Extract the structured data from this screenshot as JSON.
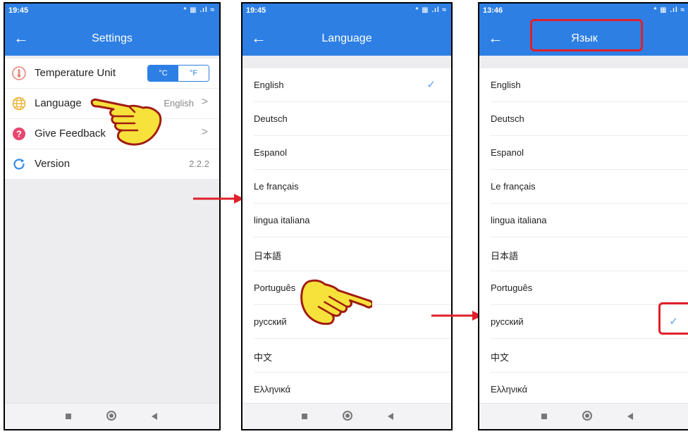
{
  "colors": {
    "primary": "#2d7fe4",
    "check": "#5aa0ef",
    "highlight": "#e0202a"
  },
  "screen1": {
    "time": "19:45",
    "status_icons": "* ▦ .ıl ≈",
    "title": "Settings",
    "items": [
      {
        "label": "Temperature Unit",
        "icon": "thermometer-icon",
        "unit_c": "°C",
        "unit_f": "°F"
      },
      {
        "label": "Language",
        "icon": "globe-icon",
        "value": "English",
        "chevron": ">"
      },
      {
        "label": "Give Feedback",
        "icon": "help-icon",
        "value": "",
        "chevron": ">"
      },
      {
        "label": "Version",
        "icon": "refresh-icon",
        "value": "2.2.2"
      }
    ]
  },
  "screen2": {
    "time": "19:45",
    "status_icons": "* ▦ .ıl ≈",
    "title": "Language",
    "check": "✓",
    "languages": [
      "English",
      "Deutsch",
      "Espanol",
      "Le français",
      "lingua italiana",
      "日本語",
      "Português",
      "русский",
      "中文",
      "Ελληνικά"
    ],
    "selected_index": 0
  },
  "screen3": {
    "time": "13:46",
    "status_icons": "* ▦ .ıl ≈",
    "title": "Язык",
    "check": "✓",
    "languages": [
      "English",
      "Deutsch",
      "Espanol",
      "Le français",
      "lingua italiana",
      "日本語",
      "Português",
      "русский",
      "中文",
      "Ελληνικά"
    ],
    "selected_index": 7
  },
  "back_arrow": "←"
}
